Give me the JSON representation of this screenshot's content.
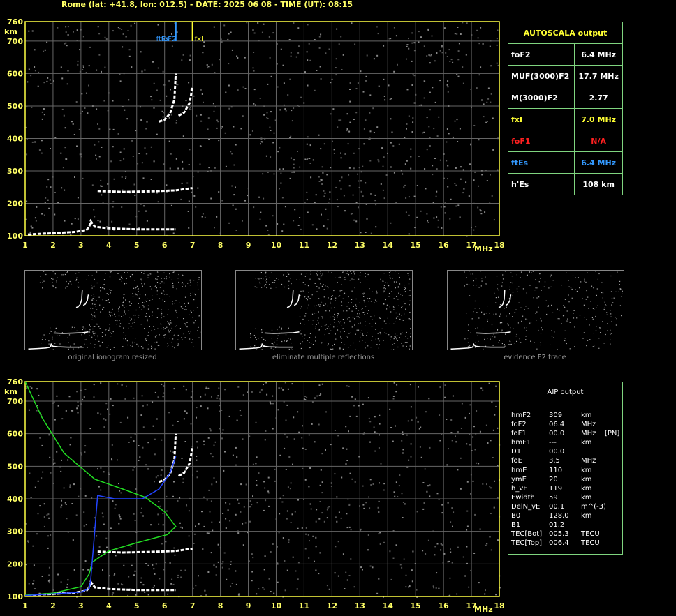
{
  "header": "Rome (lat: +41.8, lon: 012.5) - DATE: 2025 06 08 - TIME (UT): 08:15",
  "autoscala": {
    "title": "AUTOSCALA output",
    "rows": [
      {
        "label": "foF2",
        "value": "6.4 MHz",
        "color": "#ffffff"
      },
      {
        "label": "MUF(3000)F2",
        "value": "17.7 MHz",
        "color": "#ffffff"
      },
      {
        "label": "M(3000)F2",
        "value": "2.77",
        "color": "#ffffff"
      },
      {
        "label": "fxI",
        "value": "7.0 MHz",
        "color": "#ffff33"
      },
      {
        "label": "foF1",
        "value": "N/A",
        "color": "#ff2020"
      },
      {
        "label": "ftEs",
        "value": "6.4 MHz",
        "color": "#3399ff"
      },
      {
        "label": "h'Es",
        "value": "108    km",
        "color": "#ffffff"
      }
    ]
  },
  "aip": {
    "title": "AIP output",
    "rows": [
      {
        "name": "hmF2",
        "value": "309",
        "unit": "km",
        "extra": ""
      },
      {
        "name": "foF2",
        "value": "06.4",
        "unit": "MHz",
        "extra": ""
      },
      {
        "name": "foF1",
        "value": "00.0",
        "unit": "MHz",
        "extra": "[PN]"
      },
      {
        "name": "hmF1",
        "value": "---",
        "unit": "km",
        "extra": ""
      },
      {
        "name": "D1",
        "value": "00.0",
        "unit": "",
        "extra": ""
      },
      {
        "name": "foE",
        "value": "3.5",
        "unit": "MHz",
        "extra": ""
      },
      {
        "name": "hmE",
        "value": "110",
        "unit": "km",
        "extra": ""
      },
      {
        "name": "ymE",
        "value": "20",
        "unit": "km",
        "extra": ""
      },
      {
        "name": "h_vE",
        "value": "119",
        "unit": "km",
        "extra": ""
      },
      {
        "name": "Ewidth",
        "value": "59",
        "unit": "km",
        "extra": ""
      },
      {
        "name": "DelN_vE",
        "value": "00.1",
        "unit": "m^(-3)",
        "extra": ""
      },
      {
        "name": "B0",
        "value": "128.0",
        "unit": "km",
        "extra": ""
      },
      {
        "name": "B1",
        "value": "01.2",
        "unit": "",
        "extra": ""
      },
      {
        "name": "TEC[Bot]",
        "value": "005.3",
        "unit": "TECU",
        "extra": ""
      },
      {
        "name": "TEC[Top]",
        "value": "006.4",
        "unit": "TECU",
        "extra": ""
      }
    ]
  },
  "captions": {
    "original": "original ionogram resized",
    "multiple": "eliminate multiple reflections",
    "evidence": "evidence F2 trace"
  },
  "chart_data": [
    {
      "type": "scatter",
      "name": "ionogram",
      "xlabel": "MHz",
      "ylabel": "km",
      "xlim": [
        1,
        18
      ],
      "ylim": [
        100,
        760
      ],
      "xticks": [
        1,
        2,
        3,
        4,
        5,
        6,
        7,
        8,
        9,
        10,
        11,
        12,
        13,
        14,
        15,
        16,
        17,
        18
      ],
      "yticks": [
        100,
        200,
        300,
        400,
        500,
        600,
        700,
        760
      ],
      "grid": true,
      "markers": [
        {
          "label": "ftEs",
          "freq": 6.4,
          "color": "#3399ff"
        },
        {
          "label": "foF2",
          "freq": 6.4,
          "color": "#3399ff"
        },
        {
          "label": "fxI",
          "freq": 7.0,
          "color": "#ffff33"
        }
      ],
      "traces": [
        {
          "name": "E/Es",
          "points": [
            [
              1.1,
              104
            ],
            [
              2,
              108
            ],
            [
              2.8,
              112
            ],
            [
              3.2,
              118
            ],
            [
              3.3,
              128
            ],
            [
              3.35,
              145
            ],
            [
              3.5,
              128
            ],
            [
              4,
              123
            ],
            [
              5,
              120
            ],
            [
              6.4,
              120
            ]
          ]
        },
        {
          "name": "Es2",
          "points": [
            [
              3.6,
              238
            ],
            [
              4.5,
              235
            ],
            [
              5.5,
              237
            ],
            [
              6.4,
              240
            ],
            [
              7.0,
              247
            ]
          ]
        },
        {
          "name": "F2o",
          "points": [
            [
              5.8,
              452
            ],
            [
              6.0,
              458
            ],
            [
              6.2,
              478
            ],
            [
              6.35,
              520
            ],
            [
              6.4,
              600
            ]
          ]
        },
        {
          "name": "F2x",
          "points": [
            [
              6.5,
              470
            ],
            [
              6.7,
              480
            ],
            [
              6.9,
              510
            ],
            [
              7.0,
              560
            ]
          ]
        }
      ]
    },
    {
      "type": "line",
      "name": "profile",
      "xlabel": "MHz",
      "ylabel": "km",
      "xlim": [
        1,
        18
      ],
      "ylim": [
        100,
        760
      ],
      "xticks": [
        1,
        2,
        3,
        4,
        5,
        6,
        7,
        8,
        9,
        10,
        11,
        12,
        13,
        14,
        15,
        16,
        17,
        18
      ],
      "yticks": [
        100,
        200,
        300,
        400,
        500,
        600,
        700,
        760
      ],
      "grid": true,
      "series": [
        {
          "name": "",
          "color": "#22dd22",
          "points": [
            [
              1.0,
              760
            ],
            [
              1.6,
              650
            ],
            [
              2.4,
              540
            ],
            [
              3.5,
              460
            ],
            [
              4.5,
              430
            ],
            [
              5.3,
              405
            ],
            [
              6.0,
              360
            ],
            [
              6.4,
              315
            ],
            [
              6.1,
              290
            ],
            [
              5.0,
              265
            ],
            [
              4.0,
              240
            ],
            [
              3.4,
              205
            ],
            [
              3.3,
              170
            ],
            [
              3.0,
              130
            ],
            [
              2.0,
              110
            ],
            [
              1.0,
              104
            ]
          ]
        },
        {
          "name": "",
          "color": "#2244ff",
          "points": [
            [
              1.0,
              103
            ],
            [
              2.0,
              108
            ],
            [
              3.0,
              113
            ],
            [
              3.3,
              125
            ],
            [
              3.35,
              150
            ],
            [
              3.6,
              410
            ],
            [
              4.2,
              400
            ],
            [
              5.2,
              400
            ],
            [
              5.8,
              430
            ],
            [
              6.2,
              480
            ],
            [
              6.4,
              530
            ]
          ]
        }
      ],
      "traces": [
        {
          "name": "E/Es",
          "points": [
            [
              1.1,
              104
            ],
            [
              2,
              108
            ],
            [
              2.8,
              112
            ],
            [
              3.2,
              118
            ],
            [
              3.3,
              128
            ],
            [
              3.35,
              145
            ],
            [
              3.5,
              128
            ],
            [
              4,
              123
            ],
            [
              5,
              120
            ],
            [
              6.4,
              120
            ]
          ]
        },
        {
          "name": "Es2",
          "points": [
            [
              3.6,
              238
            ],
            [
              4.5,
              235
            ],
            [
              5.5,
              237
            ],
            [
              6.4,
              240
            ],
            [
              7.0,
              247
            ]
          ]
        },
        {
          "name": "F2o",
          "points": [
            [
              5.8,
              452
            ],
            [
              6.0,
              458
            ],
            [
              6.2,
              478
            ],
            [
              6.35,
              520
            ],
            [
              6.4,
              600
            ]
          ]
        },
        {
          "name": "F2x",
          "points": [
            [
              6.5,
              470
            ],
            [
              6.7,
              480
            ],
            [
              6.9,
              510
            ],
            [
              7.0,
              560
            ]
          ]
        }
      ]
    }
  ]
}
